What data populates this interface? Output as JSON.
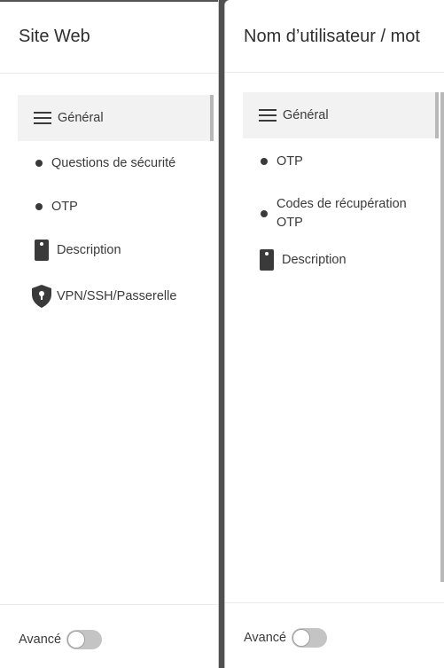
{
  "colors": {
    "backdrop": "#505050",
    "panel": "#ffffff",
    "active_bg": "#f2f2f2",
    "text": "#333333",
    "toggle_off": "#c4c4c4"
  },
  "left_panel": {
    "title": "Site Web",
    "nav": [
      {
        "label": "Général",
        "icon": "menu-icon",
        "active": true
      },
      {
        "label": "Questions de sécurité",
        "icon": "bullet-icon"
      },
      {
        "label": "OTP",
        "icon": "bullet-icon"
      },
      {
        "label": "Description",
        "icon": "tag-icon"
      },
      {
        "label": "VPN/SSH/Passerelle",
        "icon": "shield-icon"
      }
    ],
    "footer": {
      "advanced_label": "Avancé",
      "advanced_on": false
    }
  },
  "right_panel": {
    "title": "Nom d’utilisateur / mot",
    "nav": [
      {
        "label": "Général",
        "icon": "menu-icon",
        "active": true
      },
      {
        "label": "OTP",
        "icon": "bullet-icon"
      },
      {
        "label_line1": "Codes de récupération",
        "label_line2": "OTP",
        "icon": "bullet-icon"
      },
      {
        "label": "Description",
        "icon": "tag-icon"
      }
    ],
    "footer": {
      "advanced_label": "Avancé",
      "advanced_on": false
    }
  }
}
